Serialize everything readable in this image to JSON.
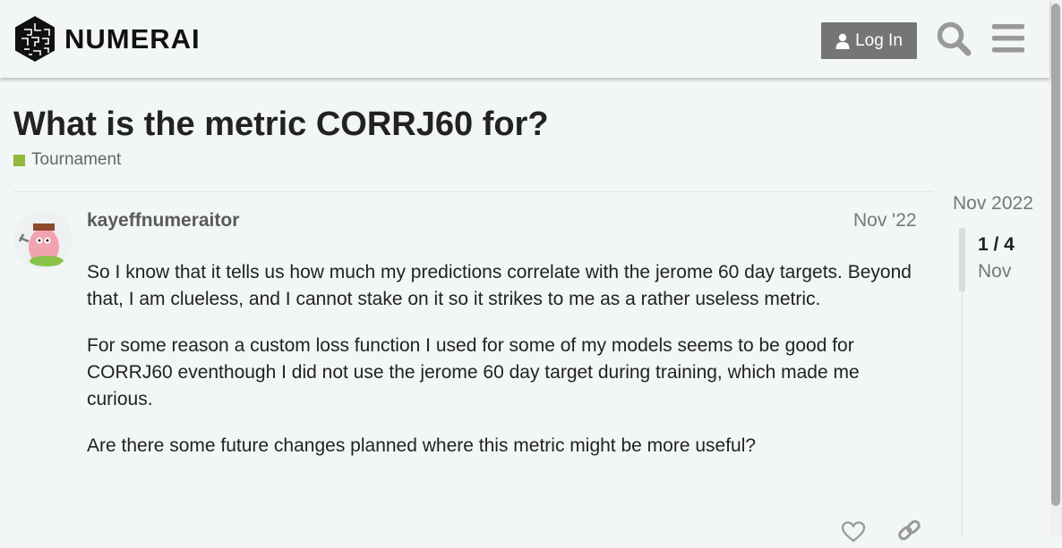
{
  "header": {
    "logo_text": "NUMERAI",
    "login_label": "Log In",
    "icons": {
      "login": "user-icon",
      "search": "search-icon",
      "menu": "hamburger-menu-icon"
    }
  },
  "topic": {
    "title": "What is the metric CORRJ60 for?",
    "category": "Tournament",
    "category_color": "#92b93b"
  },
  "post": {
    "username": "kayeffnumeraitor",
    "date": "Nov '22",
    "paragraphs": [
      "So I know that it tells us how much my predictions correlate with the jerome 60 day targets. Beyond that, I am clueless, and I cannot stake on it so it strikes to me as a rather useless metric.",
      "For some reason a custom loss function I used for some of my models seems to be good for CORRJ60 eventhough I did not use the jerome 60 day target during training, which made me curious.",
      "Are there some future changes planned where this metric might be more useful?"
    ],
    "actions": {
      "like": "heart-icon",
      "share": "link-icon"
    }
  },
  "timeline": {
    "top_date": "Nov 2022",
    "position": "1 / 4",
    "position_date": "Nov"
  },
  "colors": {
    "button": "#757575",
    "background": "#f2f6f6"
  }
}
